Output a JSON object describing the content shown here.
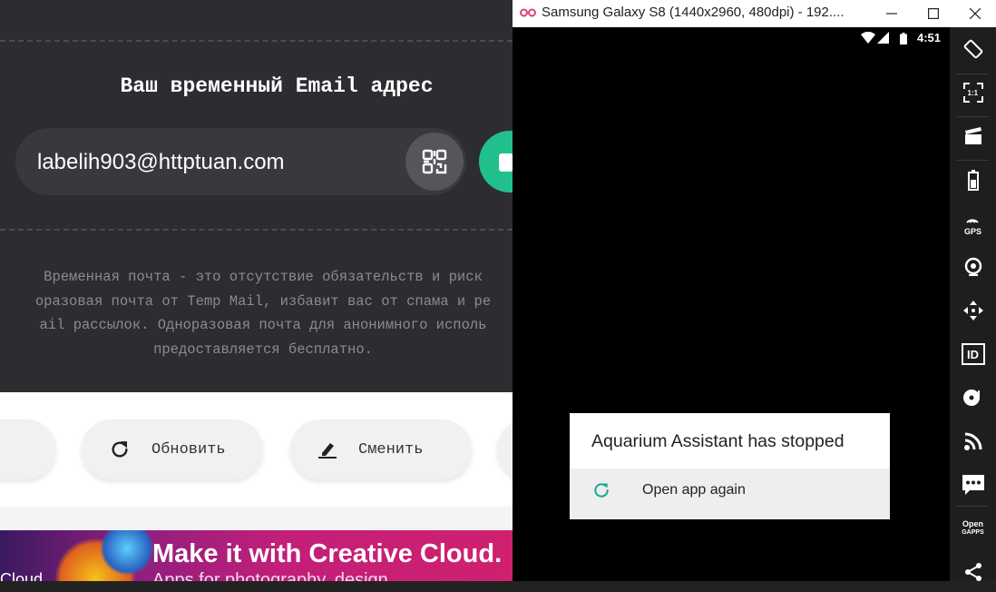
{
  "web": {
    "title": "Ваш временный Email адрес",
    "email": "labelih903@httptuan.com",
    "description_lines": [
      "Временная почта - это отсутствие обязательств и риск",
      "оразовая почта от Temp Mail, избавит вас от спама и ре",
      "ail рассылок. Одноразовая почта для анонимного исполь",
      "предоставляется бесплатно."
    ],
    "refresh_label": "Обновить",
    "change_label": "Сменить",
    "ad": {
      "headline": "Make it with Creative Cloud.",
      "subline": "Apps for photography, design,",
      "brand_fragment": "Cloud"
    },
    "colors": {
      "accent": "#21bf8c",
      "dark_bg": "#2c2c31"
    }
  },
  "emulator": {
    "window_title": "Samsung Galaxy S8 (1440x2960, 480dpi) - 192....",
    "status_time": "4:51",
    "dialog": {
      "title": "Aquarium Assistant has stopped",
      "action_label": "Open app again"
    },
    "sidebar": {
      "ratio_label": "1:1",
      "gps_label": "GPS",
      "id_label": "ID",
      "opengapps_label_1": "Open",
      "opengapps_label_2": "GAPPS"
    },
    "accent": "#1aa79a"
  }
}
